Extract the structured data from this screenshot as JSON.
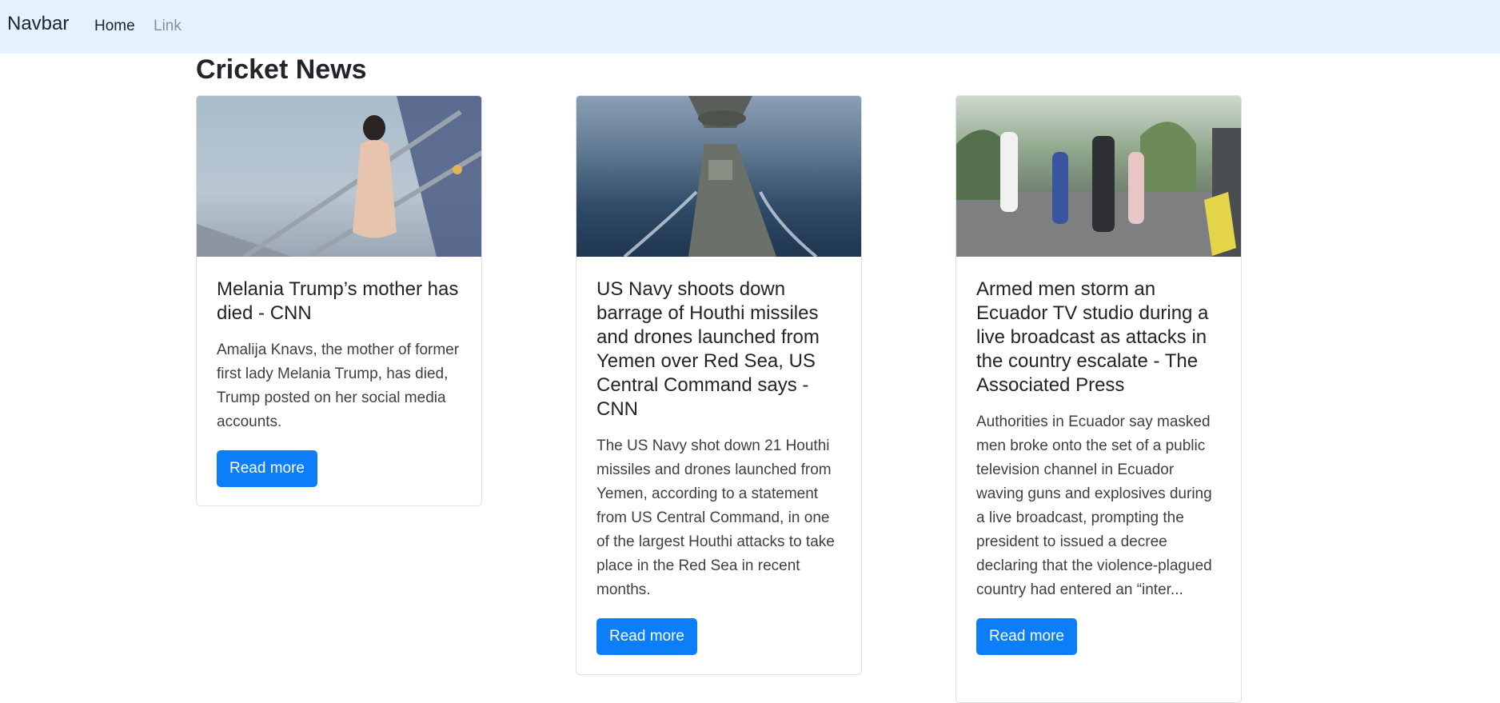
{
  "navbar": {
    "brand": "Navbar",
    "links": [
      {
        "label": "Home"
      },
      {
        "label": "Link"
      }
    ]
  },
  "page": {
    "title": "Cricket News"
  },
  "cards": [
    {
      "title": "Melania Trump’s mother has died - CNN",
      "text": "Amalija Knavs, the mother of former first lady Melania Trump, has died, Trump posted on her social media accounts.",
      "button": "Read more"
    },
    {
      "title": "US Navy shoots down barrage of Houthi missiles and drones launched from Yemen over Red Sea, US Central Command says - CNN",
      "text": "The US Navy shot down 21 Houthi missiles and drones launched from Yemen, according to a statement from US Central Command, in one of the largest Houthi attacks to take place in the Red Sea in recent months.",
      "button": "Read more"
    },
    {
      "title": "Armed men storm an Ecuador TV studio during a live broadcast as attacks in the country escalate - The Associated Press",
      "text": "Authorities in Ecuador say masked men broke onto the set of a public television channel in Ecuador waving guns and explosives during a live broadcast, prompting the president to issued a decree declaring that the violence-plagued country had entered an “inter...",
      "button": "Read more"
    }
  ],
  "colors": {
    "navbar_bg": "#e3f2fd",
    "button_bg": "#0d7ef9",
    "muted_link": "#8a8f94"
  }
}
